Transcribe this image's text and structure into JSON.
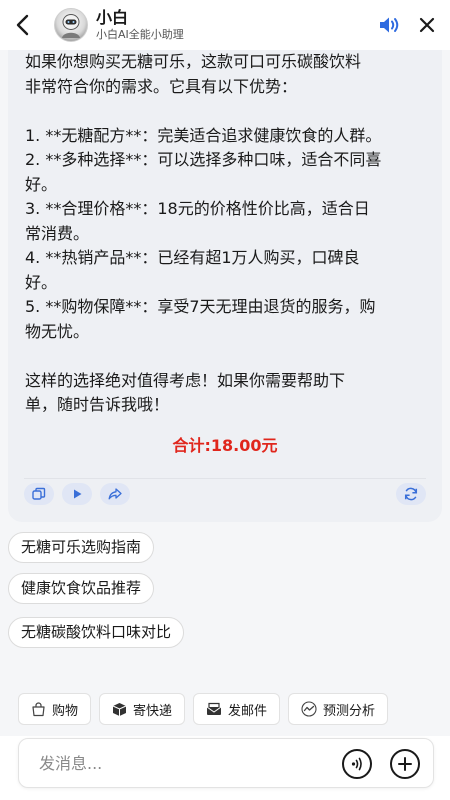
{
  "header": {
    "title": "小白",
    "subtitle": "小白AI全能小助理",
    "speaker_color": "#2f6be0"
  },
  "message": {
    "text": "如果你想购买无糖可乐，这款可口可乐碳酸饮料\n非常符合你的需求。它具有以下优势：\n\n1. **无糖配方**：完美适合追求健康饮食的人群。\n2. **多种选择**：可以选择多种口味，适合不同喜\n好。\n3. **合理价格**：18元的价格性价比高，适合日\n常消费。\n4. **热销产品**：已经有超1万人购买，口碑良\n好。\n5. **购物保障**：享受7天无理由退货的服务，购\n物无忧。\n\n这样的选择绝对值得考虑！如果你需要帮助下\n单，随时告诉我哦！",
    "total": "合计:18.00元",
    "total_color": "#e0261c"
  },
  "suggestions": [
    "无糖可乐选购指南",
    "健康饮食饮品推荐",
    "无糖碳酸饮料口味对比"
  ],
  "tools": [
    {
      "label": "购物",
      "icon": "shopping-bag-icon"
    },
    {
      "label": "寄快递",
      "icon": "package-icon"
    },
    {
      "label": "发邮件",
      "icon": "mail-icon"
    },
    {
      "label": "预测分析",
      "icon": "analysis-icon"
    }
  ],
  "input": {
    "placeholder": "发消息..."
  },
  "accent_color": "#3a6fd8"
}
